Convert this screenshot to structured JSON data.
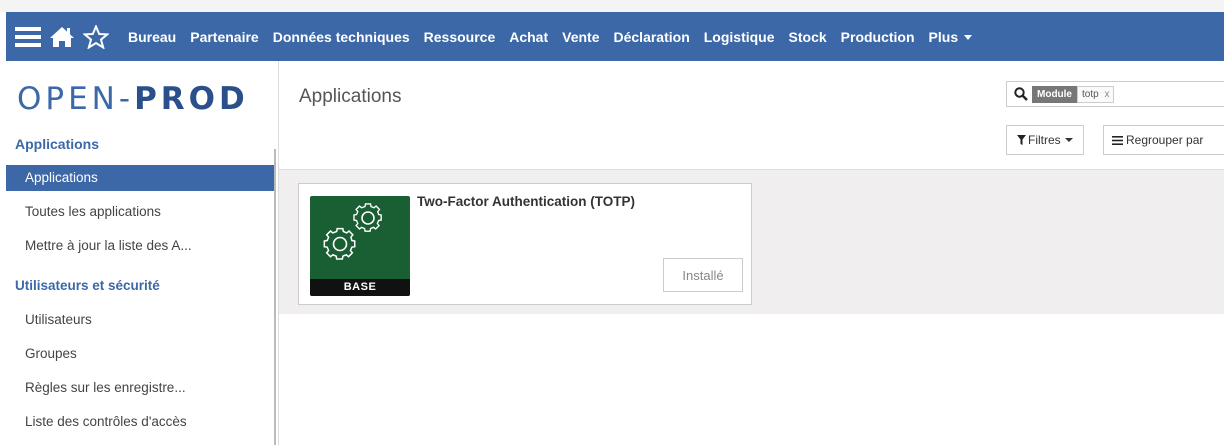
{
  "navbar": {
    "icons": [
      "hamburger-icon",
      "home-icon",
      "star-icon"
    ],
    "menu": [
      "Bureau",
      "Partenaire",
      "Données techniques",
      "Ressource",
      "Achat",
      "Vente",
      "Déclaration",
      "Logistique",
      "Stock",
      "Production"
    ],
    "more_label": "Plus"
  },
  "logo": {
    "part1": "OPEN-",
    "part2": "PROD"
  },
  "sidebar": {
    "section1": "Applications",
    "items1": [
      "Applications",
      "Toutes les applications",
      "Mettre à jour la liste des A..."
    ],
    "section2": "Utilisateurs et sécurité",
    "items2": [
      "Utilisateurs",
      "Groupes",
      "Règles sur les enregistre...",
      "Liste des contrôles d'accès"
    ]
  },
  "main": {
    "title": "Applications",
    "search": {
      "facet_label": "Module",
      "facet_value": "totp",
      "facet_remove": "x"
    },
    "filters_label": "Filtres",
    "group_label": "Regrouper par"
  },
  "card": {
    "title": "Two-Factor Authentication (TOTP)",
    "badge": "BASE",
    "button": "Installé"
  },
  "colors": {
    "accent": "#3c68a8",
    "icon_bg": "#1a5e33"
  }
}
